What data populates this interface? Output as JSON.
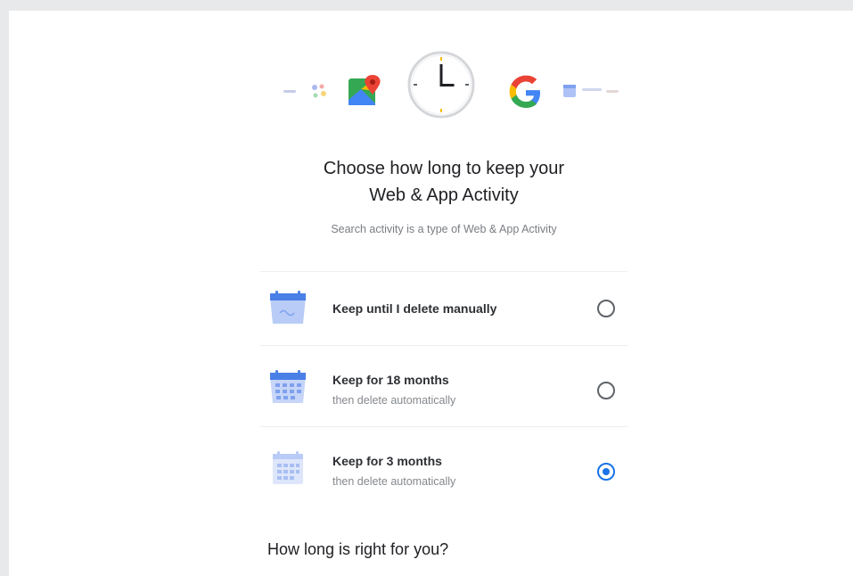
{
  "header": {
    "title_line1": "Choose how long to keep your",
    "title_line2": "Web & App Activity",
    "subtitle": "Search activity is a type of Web & App Activity"
  },
  "icons": [
    "clock-icon",
    "google-maps-icon",
    "google-g-icon"
  ],
  "options": [
    {
      "label": "Keep until I delete manually",
      "sublabel": "",
      "selected": false,
      "icon": "calendar-infinite-icon"
    },
    {
      "label": "Keep for 18 months",
      "sublabel": "then delete automatically",
      "selected": false,
      "icon": "calendar-18-icon"
    },
    {
      "label": "Keep for 3 months",
      "sublabel": "then delete automatically",
      "selected": true,
      "icon": "calendar-3-icon"
    }
  ],
  "question": "How long is right for you?",
  "colors": {
    "accent": "#1a73e8",
    "calendar": "#4285f4"
  }
}
